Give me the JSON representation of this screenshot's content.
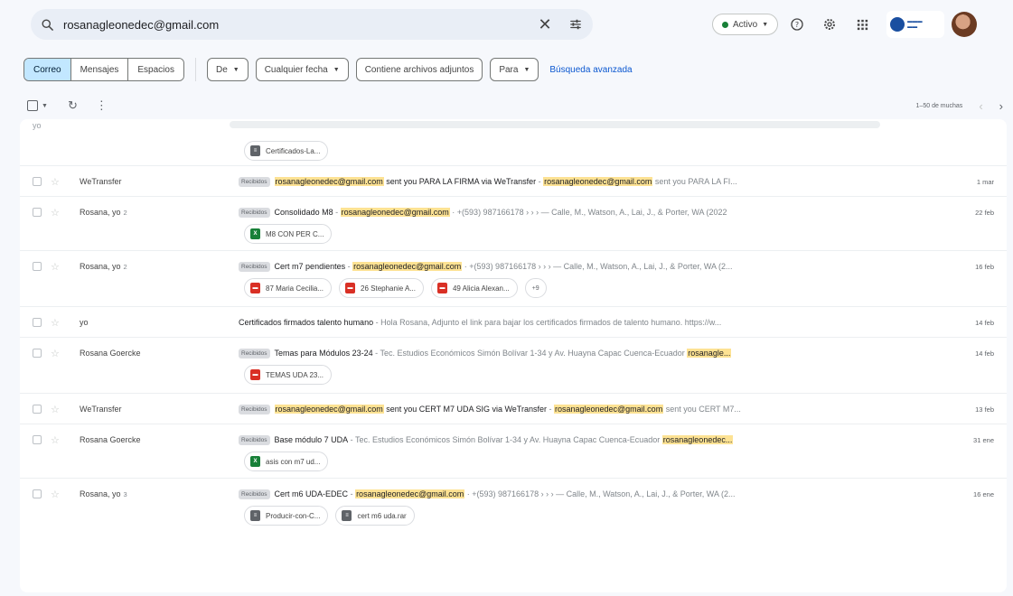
{
  "search": {
    "query": "rosanagleonedec@gmail.com"
  },
  "header": {
    "status": "Activo"
  },
  "tabs": [
    {
      "label": "Correo",
      "active": true
    },
    {
      "label": "Mensajes",
      "active": false
    },
    {
      "label": "Espacios",
      "active": false
    }
  ],
  "filters": {
    "from": "De",
    "date": "Cualquier fecha",
    "attachments": "Contiene archivos adjuntos",
    "to": "Para",
    "advanced": "Búsqueda avanzada"
  },
  "toolbar": {
    "pagination": "1–50 de muchas"
  },
  "partial_row": {
    "sender": "yo",
    "attachment": "Certificados-La..."
  },
  "emails": [
    {
      "sender": "WeTransfer",
      "count": "",
      "tag": "Recibidos",
      "subject": "rosanagleonedec@gmail.com sent you PARA LA FIRMA via WeTransfer",
      "highlight": "rosanagleonedec@gmail.com",
      "snippet": " sent you PARA LA FI...",
      "date": "1 mar",
      "attachments": []
    },
    {
      "sender": "Rosana, yo",
      "count": "2",
      "tag": "Recibidos",
      "subject": "Consolidado M8",
      "highlight": "rosanagleonedec@gmail.com",
      "snippet": " · +(593) 987166178 › › › — Calle, M., Watson, A., Lai, J., & Porter, WA (2022",
      "date": "22 feb",
      "attachments": [
        {
          "type": "xls",
          "name": "M8 CON PER C..."
        }
      ]
    },
    {
      "sender": "Rosana, yo",
      "count": "2",
      "tag": "Recibidos",
      "subject": "Cert m7 pendientes",
      "highlight": "rosanagleonedec@gmail.com",
      "snippet": " · +(593) 987166178 › › › — Calle, M., Watson, A., Lai, J., & Porter, WA (2...",
      "date": "16 feb",
      "attachments": [
        {
          "type": "pdf",
          "name": "87 Maria Cecilia..."
        },
        {
          "type": "pdf",
          "name": "26 Stephanie A..."
        },
        {
          "type": "pdf",
          "name": "49 Alicia Alexan..."
        }
      ],
      "more": "+9"
    },
    {
      "sender": "yo",
      "count": "",
      "tag": "",
      "subject": "Certificados firmados talento humano",
      "highlight": "",
      "snippet": "Hola Rosana, Adjunto el link para bajar los certificados firmados de talento humano. https://w...",
      "date": "14 feb",
      "attachments": []
    },
    {
      "sender": "Rosana Goercke",
      "count": "",
      "tag": "Recibidos",
      "subject": "Temas para Módulos 23-24",
      "highlight": "",
      "snippet": "Tec. Estudios Económicos Simón Bolívar 1-34 y Av. Huayna Capac Cuenca-Ecuador ",
      "snippet_hl": "rosanagle...",
      "date": "14 feb",
      "attachments": [
        {
          "type": "pdf",
          "name": "TEMAS UDA 23..."
        }
      ]
    },
    {
      "sender": "WeTransfer",
      "count": "",
      "tag": "Recibidos",
      "subject": "rosanagleonedec@gmail.com sent you CERT M7 UDA SIG via WeTransfer",
      "highlight": "rosanagleonedec@gmail.com",
      "snippet": " sent you CERT M7...",
      "date": "13 feb",
      "attachments": []
    },
    {
      "sender": "Rosana Goercke",
      "count": "",
      "tag": "Recibidos",
      "subject": "Base módulo 7 UDA",
      "highlight": "",
      "snippet": "Tec. Estudios Económicos Simón Bolívar 1-34 y Av. Huayna Capac Cuenca-Ecuador ",
      "snippet_hl": "rosanagleonedec...",
      "date": "31 ene",
      "attachments": [
        {
          "type": "xls",
          "name": "asis con m7 ud..."
        }
      ]
    },
    {
      "sender": "Rosana, yo",
      "count": "3",
      "tag": "Recibidos",
      "subject": "Cert m6 UDA-EDEC",
      "highlight": "rosanagleonedec@gmail.com",
      "snippet": " · +(593) 987166178 › › › — Calle, M., Watson, A., Lai, J., & Porter, WA (2...",
      "date": "16 ene",
      "attachments": [
        {
          "type": "doc",
          "name": "Producir-con-C..."
        },
        {
          "type": "doc",
          "name": "cert m6 uda.rar"
        }
      ]
    }
  ]
}
